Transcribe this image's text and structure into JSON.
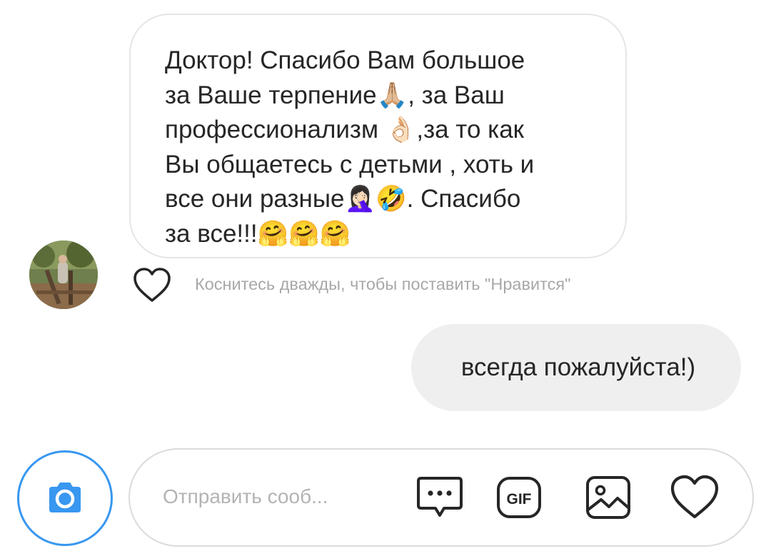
{
  "conversation": {
    "incoming_message": {
      "text": "Доктор! Спасибо Вам большое\nза Ваше терпение🙏🏼, за Ваш\nпрофессионализм 👌🏻,за то как\nВы общаетесь с детьми , хоть и\nвсе они разные🤦🏻‍♀️🤣. Спасибо\nза все!!!🤗🤗🤗"
    },
    "like_hint": "Коснитесь дважды, чтобы поставить \"Нравится\"",
    "outgoing_message": {
      "text": "всегда пожалуйста!)"
    }
  },
  "composer": {
    "placeholder": "Отправить сооб...",
    "value": "",
    "gif_label": "GIF"
  },
  "colors": {
    "accent": "#3897f0",
    "bubble_border": "#e6e6e6",
    "outgoing_bg": "#efefef",
    "hint_text": "#a8a8a8"
  },
  "icons": {
    "avatar": "user-photo",
    "like": "heart-outline-icon",
    "camera": "camera-icon",
    "chat_options": "chat-bubble-dots-icon",
    "gif": "gif-icon",
    "gallery": "image-icon",
    "composer_like": "heart-outline-icon"
  }
}
